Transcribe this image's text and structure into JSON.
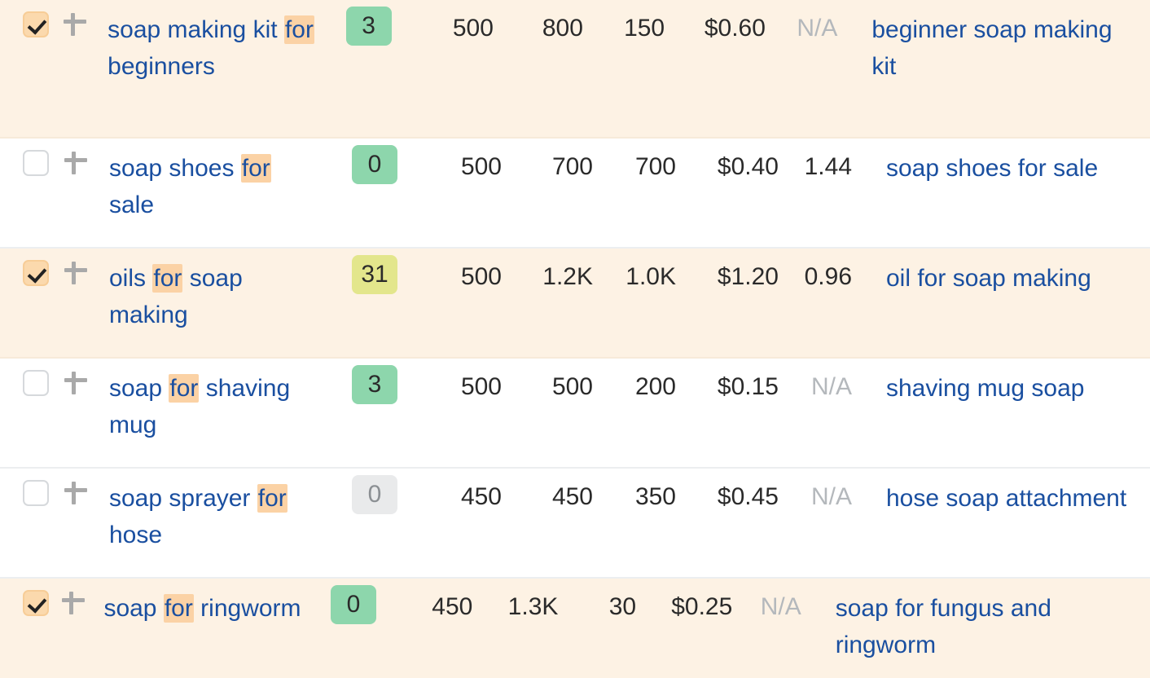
{
  "table": {
    "highlight_term": "for",
    "colors": {
      "link": "#1a4fa0",
      "highlight": "#fbd2a5",
      "selected_row": "#fdf2e4",
      "badge_green": "#8dd6ac",
      "badge_lime": "#e3e68c",
      "badge_grey": "#e9eaeb",
      "checkbox_checked": "#fbd9ad",
      "na_text": "#b4b8bc"
    },
    "icons": {
      "checkbox_checked": "checkbox-checked-icon",
      "checkbox_unchecked": "checkbox-unchecked-icon",
      "add": "plus-icon"
    },
    "rows": [
      {
        "selected": true,
        "checked": true,
        "keyword_parts": [
          {
            "text": "soap making kit ",
            "highlight": false
          },
          {
            "text": "for",
            "highlight": true
          },
          {
            "text": " beginners",
            "highlight": false
          }
        ],
        "keyword_plain": "soap making kit for beginners",
        "difficulty": "3",
        "difficulty_color": "green",
        "volume": "500",
        "traffic_potential": "800",
        "global_volume": "150",
        "cpc": "$0.60",
        "ratio": "N/A",
        "ratio_na": true,
        "parent_topic": "beginner soap making kit"
      },
      {
        "selected": false,
        "checked": false,
        "keyword_parts": [
          {
            "text": "soap shoes ",
            "highlight": false
          },
          {
            "text": "for",
            "highlight": true
          },
          {
            "text": " sale",
            "highlight": false
          }
        ],
        "keyword_plain": "soap shoes for sale",
        "difficulty": "0",
        "difficulty_color": "green",
        "volume": "500",
        "traffic_potential": "700",
        "global_volume": "700",
        "cpc": "$0.40",
        "ratio": "1.44",
        "ratio_na": false,
        "parent_topic": "soap shoes for sale"
      },
      {
        "selected": true,
        "checked": true,
        "keyword_parts": [
          {
            "text": "oils ",
            "highlight": false
          },
          {
            "text": "for",
            "highlight": true
          },
          {
            "text": " soap making",
            "highlight": false
          }
        ],
        "keyword_plain": "oils for soap making",
        "difficulty": "31",
        "difficulty_color": "lime",
        "volume": "500",
        "traffic_potential": "1.2K",
        "global_volume": "1.0K",
        "cpc": "$1.20",
        "ratio": "0.96",
        "ratio_na": false,
        "parent_topic": "oil for soap making"
      },
      {
        "selected": false,
        "checked": false,
        "keyword_parts": [
          {
            "text": "soap ",
            "highlight": false
          },
          {
            "text": "for",
            "highlight": true
          },
          {
            "text": " shaving mug",
            "highlight": false
          }
        ],
        "keyword_plain": "soap for shaving mug",
        "difficulty": "3",
        "difficulty_color": "green",
        "volume": "500",
        "traffic_potential": "500",
        "global_volume": "200",
        "cpc": "$0.15",
        "ratio": "N/A",
        "ratio_na": true,
        "parent_topic": "shaving mug soap"
      },
      {
        "selected": false,
        "checked": false,
        "keyword_parts": [
          {
            "text": "soap sprayer ",
            "highlight": false
          },
          {
            "text": "for",
            "highlight": true
          },
          {
            "text": " hose",
            "highlight": false
          }
        ],
        "keyword_plain": "soap sprayer for hose",
        "difficulty": "0",
        "difficulty_color": "grey",
        "volume": "450",
        "traffic_potential": "450",
        "global_volume": "350",
        "cpc": "$0.45",
        "ratio": "N/A",
        "ratio_na": true,
        "parent_topic": "hose soap attachment"
      },
      {
        "selected": true,
        "checked": true,
        "keyword_parts": [
          {
            "text": "soap ",
            "highlight": false
          },
          {
            "text": "for",
            "highlight": true
          },
          {
            "text": " ringworm",
            "highlight": false
          }
        ],
        "keyword_plain": "soap for ringworm",
        "difficulty": "0",
        "difficulty_color": "green",
        "volume": "450",
        "traffic_potential": "1.3K",
        "global_volume": "30",
        "cpc": "$0.25",
        "ratio": "N/A",
        "ratio_na": true,
        "parent_topic": "soap for fungus and ringworm"
      }
    ]
  }
}
